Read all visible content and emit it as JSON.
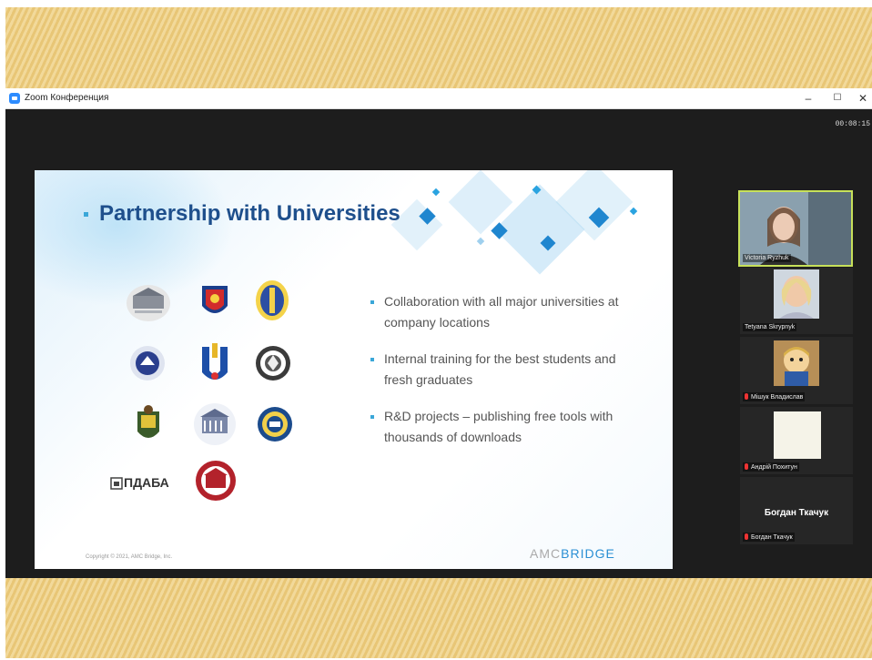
{
  "window": {
    "title": "Zoom Конференция",
    "controls": {
      "minimize": "–",
      "maximize": "☐",
      "close": "✕"
    }
  },
  "meeting": {
    "timer": "00:08:15"
  },
  "slide": {
    "title": "Partnership with Universities",
    "logo_text": "ПДАБА",
    "bullets": [
      "Collaboration with all major universities at company locations",
      "Internal training for the best students and fresh graduates",
      "R&D projects – publishing free tools with thousands of downloads"
    ],
    "copyright": "Copyright © 2021, AMC Bridge, Inc.",
    "brand": {
      "part1": "AMC",
      "part2": "BRIDGE"
    }
  },
  "participants": [
    {
      "name": "Victoria Ryzhuk",
      "active_speaker": true
    },
    {
      "name": "Tetyana Skrypnyk",
      "muted": false
    },
    {
      "name": "Мішук Владислав",
      "muted": true
    },
    {
      "name": "Андрій Похитун",
      "muted": true
    },
    {
      "name": "Богдан Ткачук",
      "display_name": "Богдан Ткачук",
      "muted": true
    }
  ],
  "colors": {
    "accent": "#2d8cff",
    "speaker_border": "#c7e15a",
    "slide_title": "#1e4f8c",
    "bullet": "#3aa7d8"
  }
}
